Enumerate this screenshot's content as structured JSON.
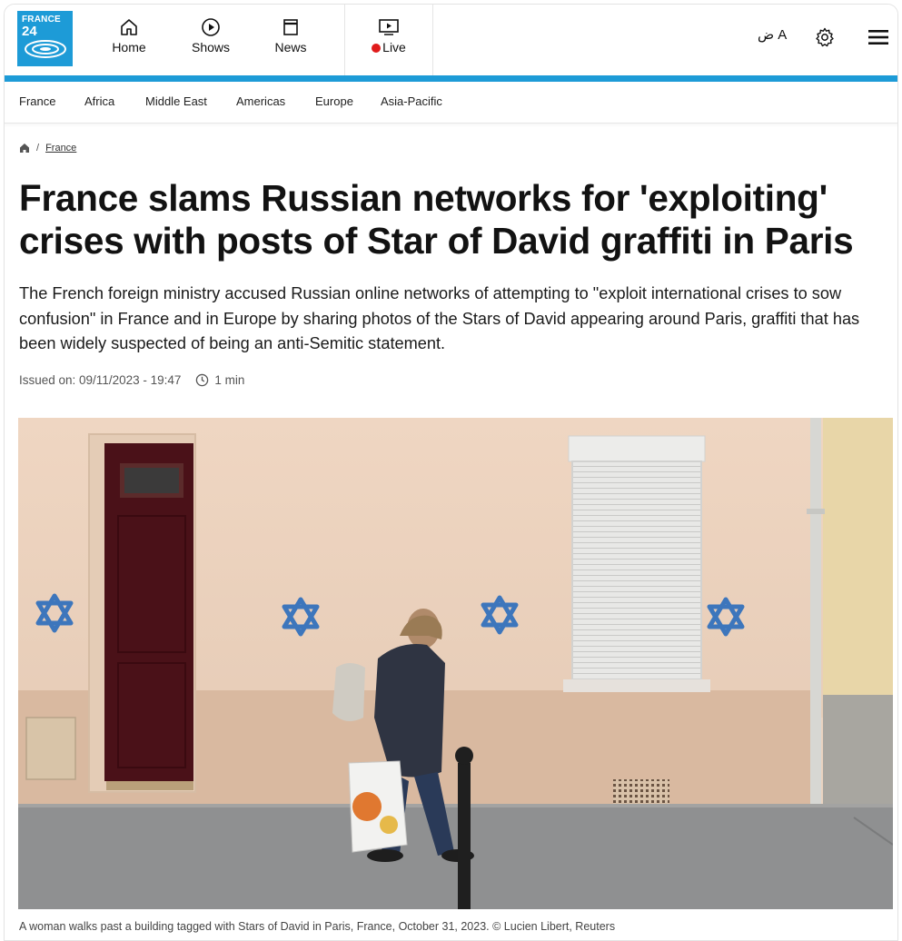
{
  "logo": {
    "line1": "FRANCE",
    "line2": "24"
  },
  "nav": {
    "home": "Home",
    "shows": "Shows",
    "news": "News",
    "live": "Live"
  },
  "header_right": {
    "lang_label": "ض A"
  },
  "sections": [
    "France",
    "Africa",
    "Middle East",
    "Americas",
    "Europe",
    "Asia-Pacific"
  ],
  "breadcrumb": {
    "current": "France"
  },
  "article": {
    "title": "France slams Russian networks for 'exploiting' crises with posts of Star of David graffiti in Paris",
    "lead": "The French foreign ministry accused Russian online networks of attempting to \"exploit international crises to sow confusion\" in France and in Europe by sharing photos of the Stars of David appearing around Paris, graffiti that has been widely suspected of being an anti-Semitic statement.",
    "issued": "Issued on: 09/11/2023 - 19:47",
    "read_time": "1 min",
    "caption": "A woman walks past a building tagged with Stars of David in Paris, France, October 31, 2023. © Lucien Libert, Reuters"
  },
  "colors": {
    "brand_blue": "#1d9bd7",
    "live_red": "#e01b1b"
  },
  "icons": {
    "home": "home-icon",
    "shows": "play-circle-icon",
    "news": "news-icon",
    "live": "tv-play-icon",
    "lang": "language-icon",
    "gear": "gear-icon",
    "menu": "hamburger-menu-icon",
    "breadcrumb": "home-small-icon",
    "clock": "clock-icon"
  }
}
